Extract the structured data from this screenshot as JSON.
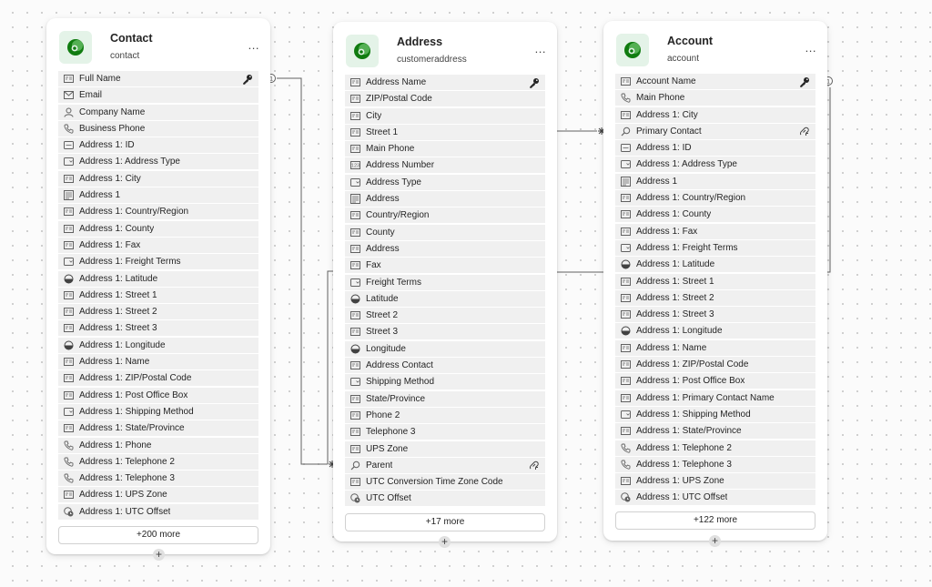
{
  "colors": {
    "accent": "#107c10",
    "brand_bg": "#e4f3e8",
    "row_bg": "#f0f0f0",
    "connector": "#616161"
  },
  "relationships": [
    {
      "from": "contact.fullname",
      "to": "customeraddress.parent",
      "from_marker": "1",
      "to_marker": "*"
    },
    {
      "from": "account.accountname",
      "to": "customeraddress.parent",
      "from_marker": "1",
      "to_marker": "*"
    },
    {
      "from": "customeraddress.street1",
      "to": "account.primarycontact",
      "from_marker": "",
      "to_marker": "*"
    }
  ],
  "tables": [
    {
      "id": "contact",
      "title": "Contact",
      "subtitle": "contact",
      "more_label": "+200 more",
      "menu_label": "...",
      "add_label": "+",
      "fields": [
        {
          "label": "Full Name",
          "icon": "text-field-icon",
          "key": "primary-key-icon"
        },
        {
          "label": "Email",
          "icon": "email-icon"
        },
        {
          "label": "Company Name",
          "icon": "person-icon"
        },
        {
          "label": "Business Phone",
          "icon": "phone-icon"
        },
        {
          "label": "Address 1: ID",
          "icon": "id-field-icon"
        },
        {
          "label": "Address 1: Address Type",
          "icon": "choice-field-icon"
        },
        {
          "label": "Address 1: City",
          "icon": "text-field-icon"
        },
        {
          "label": "Address 1",
          "icon": "multiline-text-icon"
        },
        {
          "label": "Address 1: Country/Region",
          "icon": "text-field-icon"
        },
        {
          "label": "Address 1: County",
          "icon": "text-field-icon"
        },
        {
          "label": "Address 1: Fax",
          "icon": "text-field-icon"
        },
        {
          "label": "Address 1: Freight Terms",
          "icon": "choice-field-icon"
        },
        {
          "label": "Address 1: Latitude",
          "icon": "decimal-field-icon"
        },
        {
          "label": "Address 1: Street 1",
          "icon": "text-field-icon"
        },
        {
          "label": "Address 1: Street 2",
          "icon": "text-field-icon"
        },
        {
          "label": "Address 1: Street 3",
          "icon": "text-field-icon"
        },
        {
          "label": "Address 1: Longitude",
          "icon": "decimal-field-icon"
        },
        {
          "label": "Address 1: Name",
          "icon": "text-field-icon"
        },
        {
          "label": "Address 1: ZIP/Postal Code",
          "icon": "text-field-icon"
        },
        {
          "label": "Address 1: Post Office Box",
          "icon": "text-field-icon"
        },
        {
          "label": "Address 1: Shipping Method",
          "icon": "choice-field-icon"
        },
        {
          "label": "Address 1: State/Province",
          "icon": "text-field-icon"
        },
        {
          "label": "Address 1: Phone",
          "icon": "phone-icon"
        },
        {
          "label": "Address 1: Telephone 2",
          "icon": "phone-icon"
        },
        {
          "label": "Address 1: Telephone 3",
          "icon": "phone-icon"
        },
        {
          "label": "Address 1: UPS Zone",
          "icon": "text-field-icon"
        },
        {
          "label": "Address 1: UTC Offset",
          "icon": "timezone-icon"
        }
      ]
    },
    {
      "id": "customeraddress",
      "title": "Address",
      "subtitle": "customeraddress",
      "more_label": "+17 more",
      "menu_label": "...",
      "add_label": "+",
      "fields": [
        {
          "label": "Address Name",
          "icon": "text-field-icon",
          "key": "primary-key-icon"
        },
        {
          "label": "ZIP/Postal Code",
          "icon": "text-field-icon"
        },
        {
          "label": "City",
          "icon": "text-field-icon"
        },
        {
          "label": "Street 1",
          "icon": "text-field-icon"
        },
        {
          "label": "Main Phone",
          "icon": "text-field-icon"
        },
        {
          "label": "Address Number",
          "icon": "number-field-icon"
        },
        {
          "label": "Address Type",
          "icon": "choice-field-icon"
        },
        {
          "label": "Address",
          "icon": "multiline-text-icon"
        },
        {
          "label": "Country/Region",
          "icon": "text-field-icon"
        },
        {
          "label": "County",
          "icon": "text-field-icon"
        },
        {
          "label": "Address",
          "icon": "text-field-icon"
        },
        {
          "label": "Fax",
          "icon": "text-field-icon"
        },
        {
          "label": "Freight Terms",
          "icon": "choice-field-icon"
        },
        {
          "label": "Latitude",
          "icon": "decimal-field-icon"
        },
        {
          "label": "Street 2",
          "icon": "text-field-icon"
        },
        {
          "label": "Street 3",
          "icon": "text-field-icon"
        },
        {
          "label": "Longitude",
          "icon": "decimal-field-icon"
        },
        {
          "label": "Address Contact",
          "icon": "text-field-icon"
        },
        {
          "label": "Shipping Method",
          "icon": "choice-field-icon"
        },
        {
          "label": "State/Province",
          "icon": "text-field-icon"
        },
        {
          "label": "Phone 2",
          "icon": "text-field-icon"
        },
        {
          "label": "Telephone 3",
          "icon": "text-field-icon"
        },
        {
          "label": "UPS Zone",
          "icon": "text-field-icon"
        },
        {
          "label": "Parent",
          "icon": "lookup-icon",
          "key": "relationship-icon"
        },
        {
          "label": "UTC Conversion Time Zone Code",
          "icon": "text-field-icon"
        },
        {
          "label": "UTC Offset",
          "icon": "timezone-icon"
        }
      ]
    },
    {
      "id": "account",
      "title": "Account",
      "subtitle": "account",
      "more_label": "+122 more",
      "menu_label": "...",
      "add_label": "+",
      "fields": [
        {
          "label": "Account Name",
          "icon": "text-field-icon",
          "key": "primary-key-icon"
        },
        {
          "label": "Main Phone",
          "icon": "phone-icon"
        },
        {
          "label": "Address 1: City",
          "icon": "text-field-icon"
        },
        {
          "label": "Primary Contact",
          "icon": "lookup-icon",
          "key": "relationship-icon"
        },
        {
          "label": "Address 1: ID",
          "icon": "id-field-icon"
        },
        {
          "label": "Address 1: Address Type",
          "icon": "choice-field-icon"
        },
        {
          "label": "Address 1",
          "icon": "multiline-text-icon"
        },
        {
          "label": "Address 1: Country/Region",
          "icon": "text-field-icon"
        },
        {
          "label": "Address 1: County",
          "icon": "text-field-icon"
        },
        {
          "label": "Address 1: Fax",
          "icon": "text-field-icon"
        },
        {
          "label": "Address 1: Freight Terms",
          "icon": "choice-field-icon"
        },
        {
          "label": "Address 1: Latitude",
          "icon": "decimal-field-icon"
        },
        {
          "label": "Address 1: Street 1",
          "icon": "text-field-icon"
        },
        {
          "label": "Address 1: Street 2",
          "icon": "text-field-icon"
        },
        {
          "label": "Address 1: Street 3",
          "icon": "text-field-icon"
        },
        {
          "label": "Address 1: Longitude",
          "icon": "decimal-field-icon"
        },
        {
          "label": "Address 1: Name",
          "icon": "text-field-icon"
        },
        {
          "label": "Address 1: ZIP/Postal Code",
          "icon": "text-field-icon"
        },
        {
          "label": "Address 1: Post Office Box",
          "icon": "text-field-icon"
        },
        {
          "label": "Address 1: Primary Contact Name",
          "icon": "text-field-icon"
        },
        {
          "label": "Address 1: Shipping Method",
          "icon": "choice-field-icon"
        },
        {
          "label": "Address 1: State/Province",
          "icon": "text-field-icon"
        },
        {
          "label": "Address 1: Telephone 2",
          "icon": "phone-icon"
        },
        {
          "label": "Address 1: Telephone 3",
          "icon": "phone-icon"
        },
        {
          "label": "Address 1: UPS Zone",
          "icon": "text-field-icon"
        },
        {
          "label": "Address 1: UTC Offset",
          "icon": "timezone-icon"
        }
      ]
    }
  ]
}
